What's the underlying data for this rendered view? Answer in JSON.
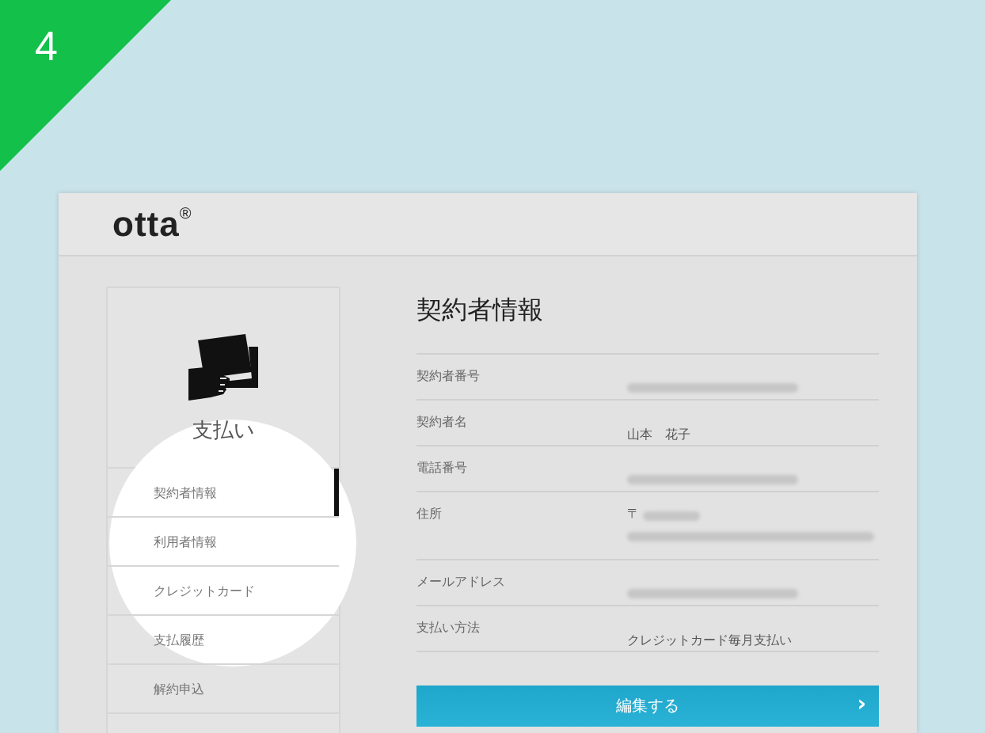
{
  "step_badge": "4",
  "header": {
    "logo": "otta",
    "logo_mark": "®"
  },
  "sidebar": {
    "title": "支払い",
    "items": [
      {
        "label": "契約者情報",
        "selected": true
      },
      {
        "label": "利用者情報",
        "selected": false
      },
      {
        "label": "クレジットカード",
        "selected": false
      },
      {
        "label": "支払履歴",
        "selected": false
      },
      {
        "label": "解約申込",
        "selected": false
      }
    ]
  },
  "main": {
    "title": "契約者情報",
    "rows": [
      {
        "label": "契約者番号",
        "kind": "blurred"
      },
      {
        "label": "契約者名",
        "kind": "text",
        "value": "山本　花子"
      },
      {
        "label": "電話番号",
        "kind": "blurred"
      },
      {
        "label": "住所",
        "kind": "blurred_address",
        "prefix": "〒"
      },
      {
        "label": "メールアドレス",
        "kind": "blurred"
      },
      {
        "label": "支払い方法",
        "kind": "text",
        "value": "クレジットカード毎月支払い"
      }
    ],
    "edit_button": {
      "label": "編集する",
      "arrow": "›"
    }
  }
}
